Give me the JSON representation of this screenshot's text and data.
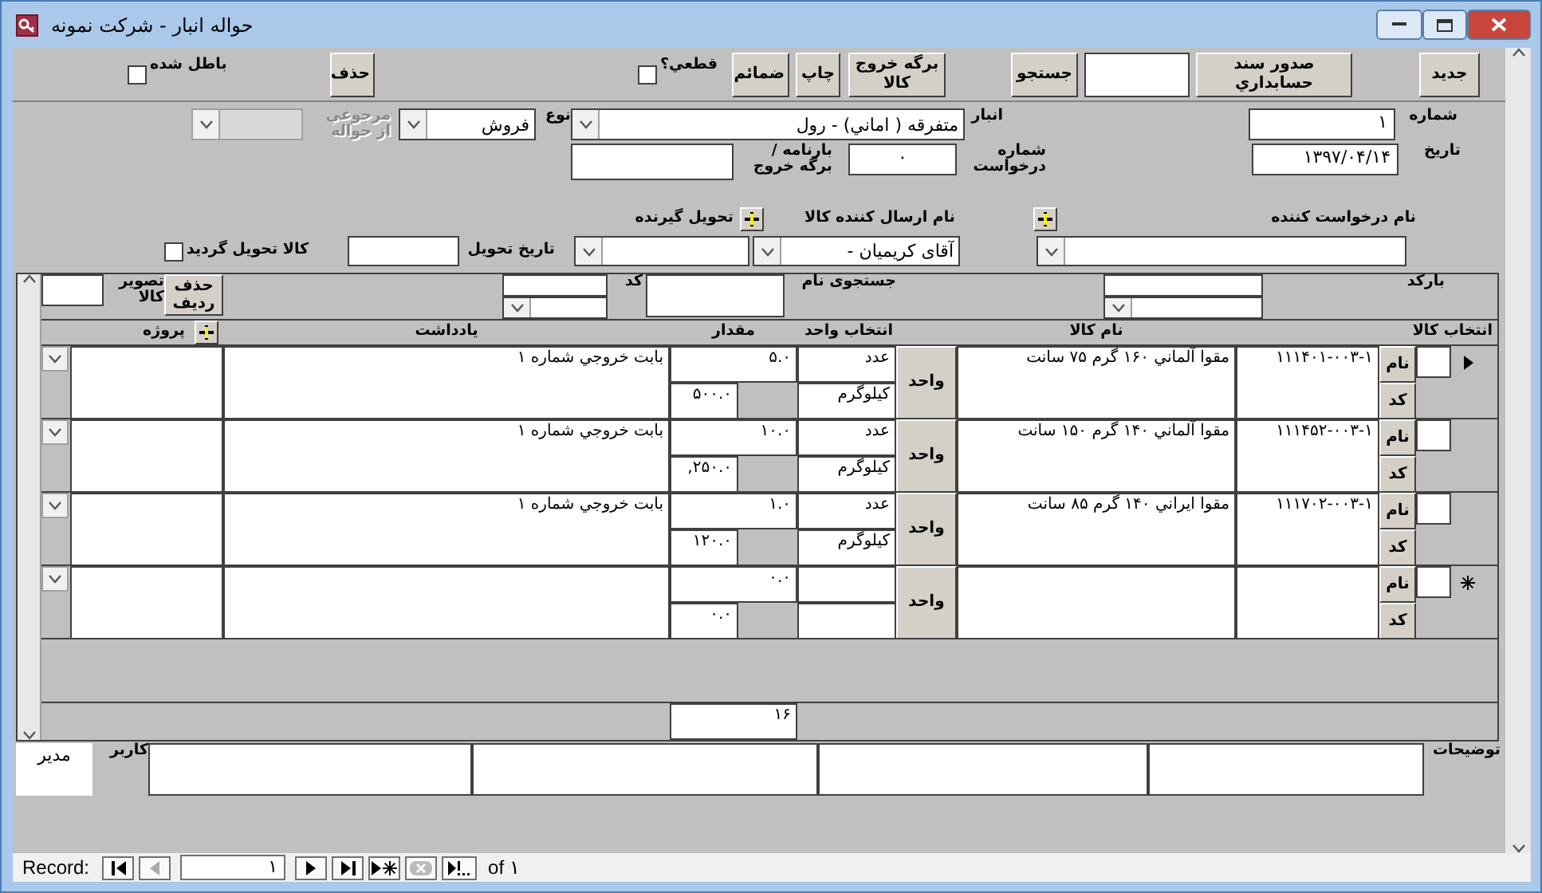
{
  "window": {
    "title": "حواله  انبار - شرکت نمونه"
  },
  "toolbar": {
    "void": {
      "label": "باطل شده",
      "checked": false
    },
    "delete_button": "حذف",
    "final": {
      "label": "قطعي؟",
      "checked": false
    },
    "attachments_button": "ضمائم",
    "print_button": "چاپ",
    "exit_slip_button": "برگه خروج کالا",
    "search_button": "جستجو",
    "voucher_button": "صدور سند حسابداري",
    "new_button": "جدید"
  },
  "header": {
    "return_of": {
      "label": "مرجوعي از حواله",
      "disabled": true
    },
    "type": {
      "label": "نوع",
      "value": "فروش"
    },
    "warehouse": {
      "label": "انبار",
      "value": "متفرقه ( اماني) - رول"
    },
    "number": {
      "label": "شماره",
      "value": "۱"
    },
    "waybill": {
      "label": "بارنامه / برگه خروج"
    },
    "request_number": {
      "label": "شماره درخواست",
      "value": "۰"
    },
    "date": {
      "label": "تاریخ",
      "value": "۱۳۹۷/۰۴/۱۴"
    },
    "requester": {
      "label": "نام درخواست کننده"
    },
    "sender": {
      "label": "نام ارسال کننده کالا",
      "value": "آقای کریمیان -"
    },
    "receiver": {
      "label": "تحویل گیرنده"
    },
    "delivery_date": {
      "label": "تاریخ تحویل"
    },
    "delivered": {
      "label": "کالا تحویل گردید",
      "checked": false
    }
  },
  "subform": {
    "image_label": "تصویر کالا",
    "delete_row_button": "حذف ردیف",
    "code_label": "کد",
    "name_search_label": "جستجوی نام",
    "barcode_label": "بارکد",
    "columns": [
      "انتخاب کالا",
      "نام کالا",
      "انتخاب واحد",
      "مقدار",
      "يادداشت",
      "پروژه"
    ],
    "rows": [
      {
        "kind": "item",
        "current": true,
        "name_button": "نام",
        "code_button": "کد",
        "code": "۱۱۱۴۰۱-۰۰۳-۱",
        "name": "مقوا آلماني ۱۶۰ گرم ۷۵ سانت",
        "unit_button": "واحد",
        "unit": "عدد",
        "alt_unit": "کیلوگرم",
        "quantity": "۵.۰",
        "total": "۵۰۰.۰",
        "note": "بابت خروجي شماره  ۱"
      },
      {
        "kind": "item",
        "current": false,
        "name_button": "نام",
        "code_button": "کد",
        "code": "۱۱۱۴۵۲-۰۰۳-۱",
        "name": "مقوا آلماني ۱۴۰ گرم ۱۵۰ سانت",
        "unit_button": "واحد",
        "unit": "عدد",
        "alt_unit": "کیلوگرم",
        "quantity": "۱۰.۰",
        "total": ",۲۵۰.۰",
        "note": "بابت خروجي شماره  ۱"
      },
      {
        "kind": "item",
        "current": false,
        "name_button": "نام",
        "code_button": "کد",
        "code": "۱۱۱۷۰۲-۰۰۳-۱",
        "name": "مقوا ايراني ۱۴۰ گرم ۸۵ سانت",
        "unit_button": "واحد",
        "unit": "عدد",
        "alt_unit": "کیلوگرم",
        "quantity": "۱.۰",
        "total": "۱۲۰.۰",
        "note": "بابت خروجي شماره  ۱"
      },
      {
        "kind": "new",
        "current": false,
        "name_button": "نام",
        "code_button": "کد",
        "unit_button": "واحد",
        "quantity": "۰.۰",
        "total": "۰.۰"
      }
    ],
    "sum": "۱۶"
  },
  "footer": {
    "notes_label": "توضیحات",
    "user_label": "کاربر",
    "user": "مدیر"
  },
  "record_nav": {
    "label": "Record:",
    "current": "۱",
    "of": "of ۱"
  }
}
